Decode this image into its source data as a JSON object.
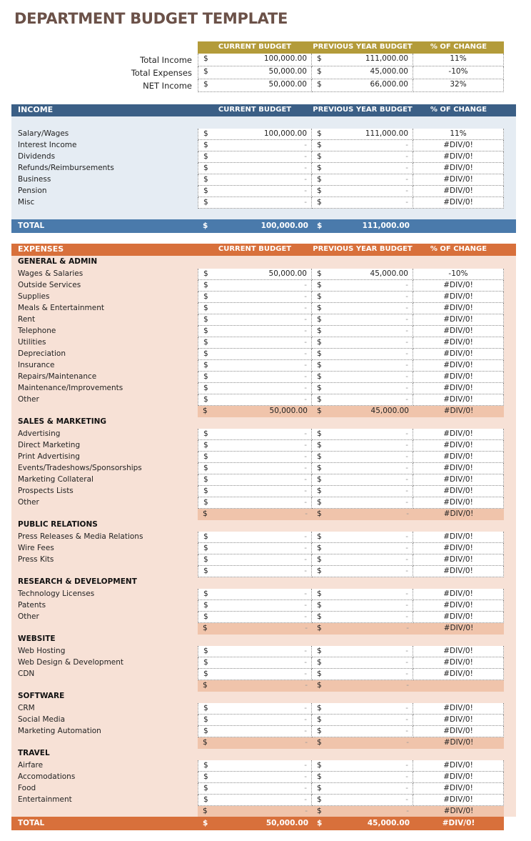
{
  "title": "DEPARTMENT BUDGET TEMPLATE",
  "columns": {
    "current": "CURRENT BUDGET",
    "previous": "PREVIOUS YEAR BUDGET",
    "change": "% OF CHANGE"
  },
  "currency": "$",
  "colors": {
    "title": "#6b5148",
    "summary_header": "#b39b3a",
    "income_header": "#3b5f86",
    "income_total": "#4a7aab",
    "income_bg": "#e5ecf3",
    "expense_header": "#d8703b",
    "expense_bg": "#f7e1d6",
    "expense_subtotal": "#f0c4ab"
  },
  "summary": {
    "rows": [
      {
        "label": "Total Income",
        "current": "100,000.00",
        "previous": "111,000.00",
        "change": "11%"
      },
      {
        "label": "Total Expenses",
        "current": "50,000.00",
        "previous": "45,000.00",
        "change": "-10%"
      },
      {
        "label": "NET Income",
        "current": "50,000.00",
        "previous": "66,000.00",
        "change": "32%"
      }
    ]
  },
  "income": {
    "title": "INCOME",
    "rows": [
      {
        "label": "Salary/Wages",
        "current": "100,000.00",
        "previous": "111,000.00",
        "change": "11%"
      },
      {
        "label": "Interest Income",
        "current": "-",
        "previous": "-",
        "change": "#DIV/0!"
      },
      {
        "label": "Dividends",
        "current": "-",
        "previous": "-",
        "change": "#DIV/0!"
      },
      {
        "label": "Refunds/Reimbursements",
        "current": "-",
        "previous": "-",
        "change": "#DIV/0!"
      },
      {
        "label": "Business",
        "current": "-",
        "previous": "-",
        "change": "#DIV/0!"
      },
      {
        "label": "Pension",
        "current": "-",
        "previous": "-",
        "change": "#DIV/0!"
      },
      {
        "label": "Misc",
        "current": "-",
        "previous": "-",
        "change": "#DIV/0!"
      }
    ],
    "total": {
      "label": "TOTAL",
      "current": "100,000.00",
      "previous": "111,000.00",
      "change": ""
    }
  },
  "expenses": {
    "title": "EXPENSES",
    "groups": [
      {
        "title": "GENERAL & ADMIN",
        "rows": [
          {
            "label": "Wages & Salaries",
            "current": "50,000.00",
            "previous": "45,000.00",
            "change": "-10%"
          },
          {
            "label": "Outside Services",
            "current": "-",
            "previous": "-",
            "change": "#DIV/0!"
          },
          {
            "label": "Supplies",
            "current": "-",
            "previous": "-",
            "change": "#DIV/0!"
          },
          {
            "label": "Meals & Entertainment",
            "current": "-",
            "previous": "-",
            "change": "#DIV/0!"
          },
          {
            "label": "Rent",
            "current": "-",
            "previous": "-",
            "change": "#DIV/0!"
          },
          {
            "label": "Telephone",
            "current": "-",
            "previous": "-",
            "change": "#DIV/0!"
          },
          {
            "label": "Utilities",
            "current": "-",
            "previous": "-",
            "change": "#DIV/0!"
          },
          {
            "label": "Depreciation",
            "current": "-",
            "previous": "-",
            "change": "#DIV/0!"
          },
          {
            "label": "Insurance",
            "current": "-",
            "previous": "-",
            "change": "#DIV/0!"
          },
          {
            "label": "Repairs/Maintenance",
            "current": "-",
            "previous": "-",
            "change": "#DIV/0!"
          },
          {
            "label": "Maintenance/Improvements",
            "current": "-",
            "previous": "-",
            "change": "#DIV/0!"
          },
          {
            "label": "Other",
            "current": "-",
            "previous": "-",
            "change": "#DIV/0!"
          }
        ],
        "subtotal": {
          "current": "50,000.00",
          "previous": "45,000.00",
          "change": "#DIV/0!",
          "highlighted": true
        }
      },
      {
        "title": "SALES & MARKETING",
        "rows": [
          {
            "label": "Advertising",
            "current": "-",
            "previous": "-",
            "change": "#DIV/0!"
          },
          {
            "label": "Direct Marketing",
            "current": "-",
            "previous": "-",
            "change": "#DIV/0!"
          },
          {
            "label": "Print Advertising",
            "current": "-",
            "previous": "-",
            "change": "#DIV/0!"
          },
          {
            "label": "Events/Tradeshows/Sponsorships",
            "current": "-",
            "previous": "-",
            "change": "#DIV/0!"
          },
          {
            "label": "Marketing Collateral",
            "current": "-",
            "previous": "-",
            "change": "#DIV/0!"
          },
          {
            "label": "Prospects Lists",
            "current": "-",
            "previous": "-",
            "change": "#DIV/0!"
          },
          {
            "label": "Other",
            "current": "-",
            "previous": "-",
            "change": "#DIV/0!"
          }
        ],
        "subtotal": {
          "current": "-",
          "previous": "-",
          "change": "#DIV/0!",
          "highlighted": true
        }
      },
      {
        "title": "PUBLIC RELATIONS",
        "rows": [
          {
            "label": "Press Releases & Media Relations",
            "current": "-",
            "previous": "-",
            "change": "#DIV/0!"
          },
          {
            "label": "Wire Fees",
            "current": "-",
            "previous": "-",
            "change": "#DIV/0!"
          },
          {
            "label": "Press Kits",
            "current": "-",
            "previous": "-",
            "change": "#DIV/0!"
          }
        ],
        "subtotal": {
          "current": "-",
          "previous": "-",
          "change": "#DIV/0!",
          "highlighted": false
        }
      },
      {
        "title": "RESEARCH & DEVELOPMENT",
        "rows": [
          {
            "label": "Technology Licenses",
            "current": "-",
            "previous": "-",
            "change": "#DIV/0!"
          },
          {
            "label": "Patents",
            "current": "-",
            "previous": "-",
            "change": "#DIV/0!"
          },
          {
            "label": "Other",
            "current": "-",
            "previous": "-",
            "change": "#DIV/0!"
          }
        ],
        "subtotal": {
          "current": "-",
          "previous": "-",
          "change": "#DIV/0!",
          "highlighted": true
        }
      },
      {
        "title": "WEBSITE",
        "rows": [
          {
            "label": "Web Hosting",
            "current": "-",
            "previous": "-",
            "change": "#DIV/0!"
          },
          {
            "label": "Web Design & Development",
            "current": "-",
            "previous": "-",
            "change": "#DIV/0!"
          },
          {
            "label": "CDN",
            "current": "-",
            "previous": "-",
            "change": "#DIV/0!"
          }
        ],
        "subtotal": {
          "current": "-",
          "previous": "-",
          "change": "",
          "highlighted": true
        }
      },
      {
        "title": "SOFTWARE",
        "rows": [
          {
            "label": "CRM",
            "current": "-",
            "previous": "-",
            "change": "#DIV/0!"
          },
          {
            "label": "Social Media",
            "current": "-",
            "previous": "-",
            "change": "#DIV/0!"
          },
          {
            "label": "Marketing Automation",
            "current": "-",
            "previous": "-",
            "change": "#DIV/0!"
          }
        ],
        "subtotal": {
          "current": "-",
          "previous": "-",
          "change": "#DIV/0!",
          "highlighted": true
        }
      },
      {
        "title": "TRAVEL",
        "rows": [
          {
            "label": "Airfare",
            "current": "-",
            "previous": "-",
            "change": "#DIV/0!"
          },
          {
            "label": "Accomodations",
            "current": "-",
            "previous": "-",
            "change": "#DIV/0!"
          },
          {
            "label": "Food",
            "current": "-",
            "previous": "-",
            "change": "#DIV/0!"
          },
          {
            "label": "Entertainment",
            "current": "-",
            "previous": "-",
            "change": "#DIV/0!"
          }
        ],
        "subtotal": {
          "current": "-",
          "previous": "-",
          "change": "#DIV/0!",
          "highlighted": true
        }
      }
    ],
    "total": {
      "label": "TOTAL",
      "current": "50,000.00",
      "previous": "45,000.00",
      "change": "#DIV/0!"
    }
  }
}
